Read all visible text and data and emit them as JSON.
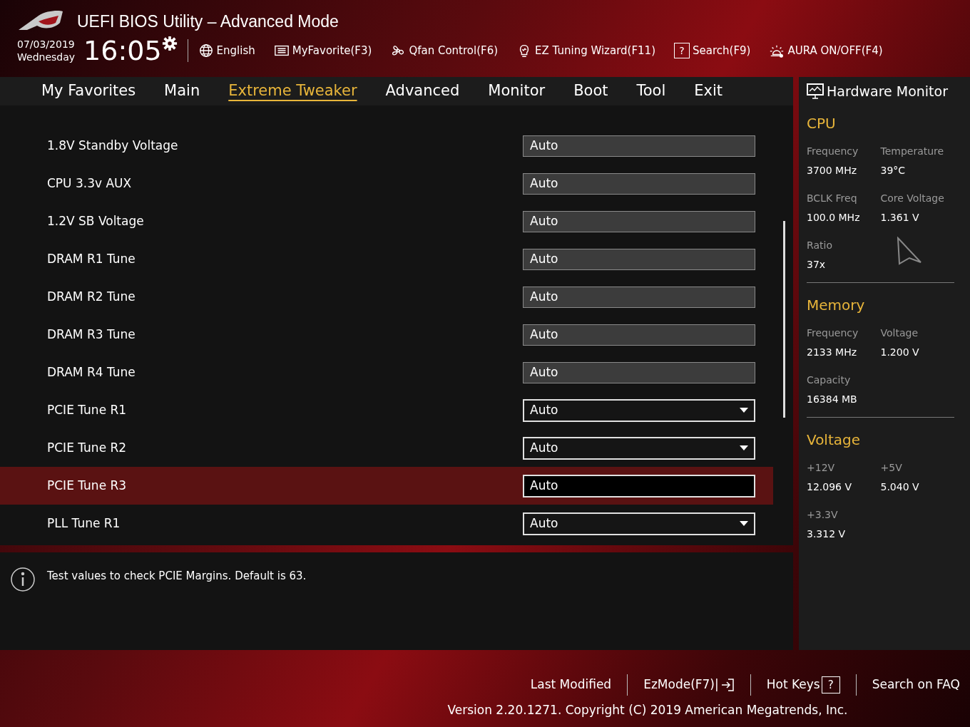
{
  "header": {
    "title": "UEFI BIOS Utility – Advanced Mode",
    "date": "07/03/2019",
    "weekday": "Wednesday",
    "time": "16:05",
    "tools": [
      {
        "kind": "globe",
        "label": "English"
      },
      {
        "kind": "favorite",
        "label": "MyFavorite(F3)"
      },
      {
        "kind": "fan",
        "label": "Qfan Control(F6)"
      },
      {
        "kind": "bulb",
        "label": "EZ Tuning Wizard(F11)"
      },
      {
        "kind": "help",
        "label": "Search(F9)",
        "glyph": "?"
      },
      {
        "kind": "aura",
        "label": "AURA ON/OFF(F4)"
      }
    ]
  },
  "tabs": [
    {
      "label": "My Favorites",
      "selected": false
    },
    {
      "label": "Main",
      "selected": false
    },
    {
      "label": "Extreme Tweaker",
      "selected": true
    },
    {
      "label": "Advanced",
      "selected": false
    },
    {
      "label": "Monitor",
      "selected": false
    },
    {
      "label": "Boot",
      "selected": false
    },
    {
      "label": "Tool",
      "selected": false
    },
    {
      "label": "Exit",
      "selected": false
    }
  ],
  "settings": [
    {
      "label": "1.8V Standby Voltage",
      "value": "Auto",
      "kind": "fixed",
      "selected": false
    },
    {
      "label": "CPU 3.3v AUX",
      "value": "Auto",
      "kind": "fixed",
      "selected": false
    },
    {
      "label": "1.2V SB Voltage",
      "value": "Auto",
      "kind": "fixed",
      "selected": false
    },
    {
      "label": "DRAM R1 Tune",
      "value": "Auto",
      "kind": "fixed",
      "selected": false
    },
    {
      "label": "DRAM R2 Tune",
      "value": "Auto",
      "kind": "fixed",
      "selected": false
    },
    {
      "label": "DRAM R3 Tune",
      "value": "Auto",
      "kind": "fixed",
      "selected": false
    },
    {
      "label": "DRAM R4 Tune",
      "value": "Auto",
      "kind": "fixed",
      "selected": false
    },
    {
      "label": "PCIE Tune R1",
      "value": "Auto",
      "kind": "dropdown",
      "selected": false
    },
    {
      "label": "PCIE Tune R2",
      "value": "Auto",
      "kind": "dropdown",
      "selected": false
    },
    {
      "label": "PCIE Tune R3",
      "value": "Auto",
      "kind": "input",
      "selected": true
    },
    {
      "label": "PLL Tune R1",
      "value": "Auto",
      "kind": "dropdown",
      "selected": false
    }
  ],
  "help_text": "Test values to check PCIE Margins. Default is 63.",
  "hardware_monitor": {
    "title": "Hardware Monitor",
    "sections": [
      {
        "title": "CPU",
        "items": [
          {
            "label": "Frequency",
            "value": "3700 MHz"
          },
          {
            "label": "Temperature",
            "value": "39°C"
          },
          {
            "label": "BCLK Freq",
            "value": "100.0 MHz"
          },
          {
            "label": "Core Voltage",
            "value": "1.361 V"
          },
          {
            "label": "Ratio",
            "value": "37x"
          }
        ]
      },
      {
        "title": "Memory",
        "items": [
          {
            "label": "Frequency",
            "value": "2133 MHz"
          },
          {
            "label": "Voltage",
            "value": "1.200 V"
          },
          {
            "label": "Capacity",
            "value": "16384 MB"
          }
        ]
      },
      {
        "title": "Voltage",
        "items": [
          {
            "label": "+12V",
            "value": "12.096 V"
          },
          {
            "label": "+5V",
            "value": "5.040 V"
          },
          {
            "label": "+3.3V",
            "value": "3.312 V"
          }
        ]
      }
    ]
  },
  "footer": {
    "links": [
      {
        "kind": "plain",
        "label": "Last Modified"
      },
      {
        "kind": "exit",
        "label": "EzMode(F7)|"
      },
      {
        "kind": "help",
        "label": "Hot Keys",
        "glyph": "?"
      },
      {
        "kind": "plain",
        "label": "Search on FAQ"
      }
    ],
    "version": "Version 2.20.1271. Copyright (C) 2019 American Megatrends, Inc."
  }
}
